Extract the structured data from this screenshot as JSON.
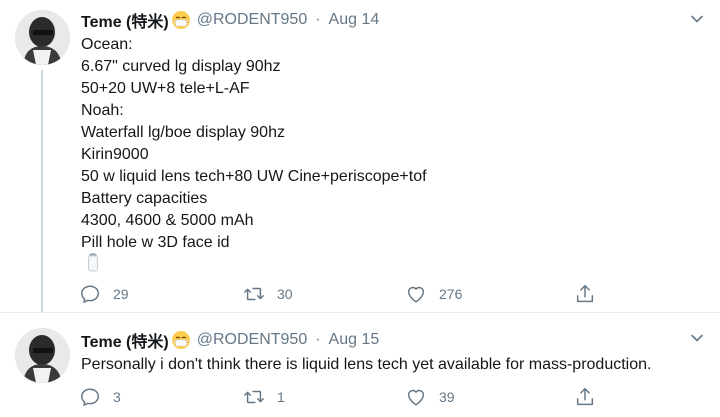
{
  "tweets": [
    {
      "name": "Teme (特米)",
      "handle": "@RODENT950",
      "separator": "·",
      "date": "Aug 14",
      "lines": [
        "Ocean:",
        "6.67\" curved lg display 90hz",
        "50+20 UW+8 tele+L-AF",
        "Noah:",
        "Waterfall lg/boe display 90hz",
        "Kirin9000",
        "50 w liquid lens tech+80 UW Cine+periscope+tof",
        "Battery capacities",
        "4300, 4600 & 5000 mAh",
        "Pill hole w 3D face id"
      ],
      "replies": "29",
      "retweets": "30",
      "likes": "276"
    },
    {
      "name": "Teme (特米)",
      "handle": "@RODENT950",
      "separator": "·",
      "date": "Aug 15",
      "lines": [
        "Personally i don't think there is liquid lens tech yet available for mass-production."
      ],
      "replies": "3",
      "retweets": "1",
      "likes": "39"
    }
  ],
  "icons": {
    "reply": "reply-icon",
    "retweet": "retweet-icon",
    "like": "heart-icon",
    "share": "share-icon",
    "menu": "chevron-down-icon",
    "emoji": "mask-face-emoji-icon",
    "salt": "salt-shaker-emoji-icon"
  },
  "colors": {
    "text": "#14171a",
    "secondary": "#657786",
    "divider": "#e6ecf0"
  }
}
